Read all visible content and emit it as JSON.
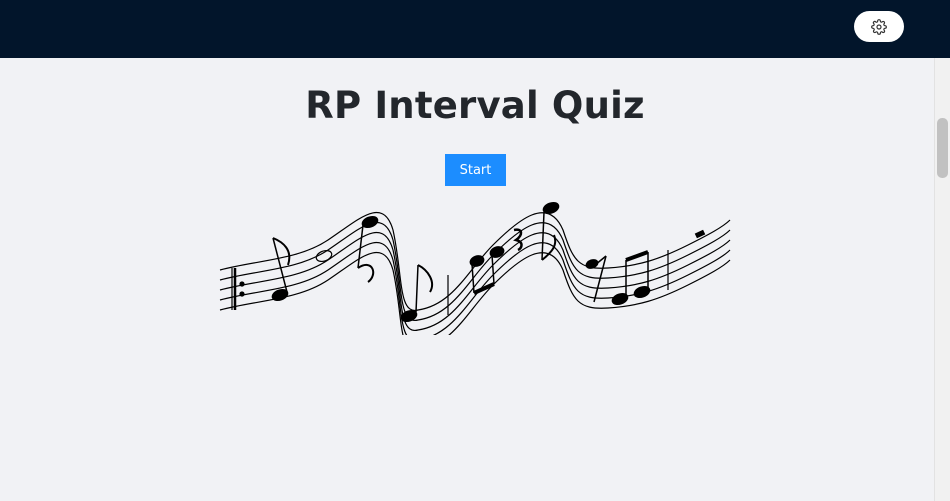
{
  "header": {
    "settings_icon": "gear-icon",
    "background": "#02152b"
  },
  "main": {
    "title": "RP Interval Quiz",
    "start_label": "Start",
    "accent": "#1c8dff"
  },
  "illustration": {
    "description_icon": "music-staff-illustration"
  }
}
